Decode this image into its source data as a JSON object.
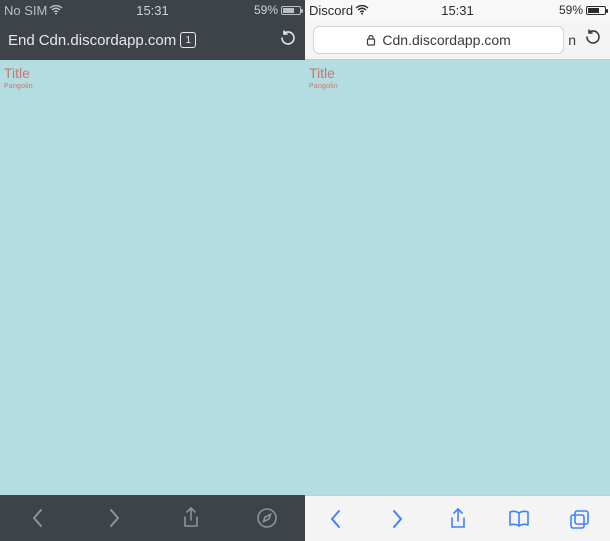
{
  "left": {
    "status": {
      "carrier": "No SIM",
      "time": "15:31",
      "battery_pct": "59%"
    },
    "nav": {
      "prefix": "End",
      "url": "Cdn.discordapp.com",
      "tab_count": "1"
    },
    "page": {
      "title": "Title",
      "subtext": "Pangolin"
    }
  },
  "right": {
    "status": {
      "carrier": "Discord",
      "time": "15:31",
      "battery_pct": "59%"
    },
    "nav": {
      "url": "Cdn.discordapp.com",
      "suffix": "n"
    },
    "page": {
      "title": "Title",
      "subtext": "Pangolin"
    }
  }
}
